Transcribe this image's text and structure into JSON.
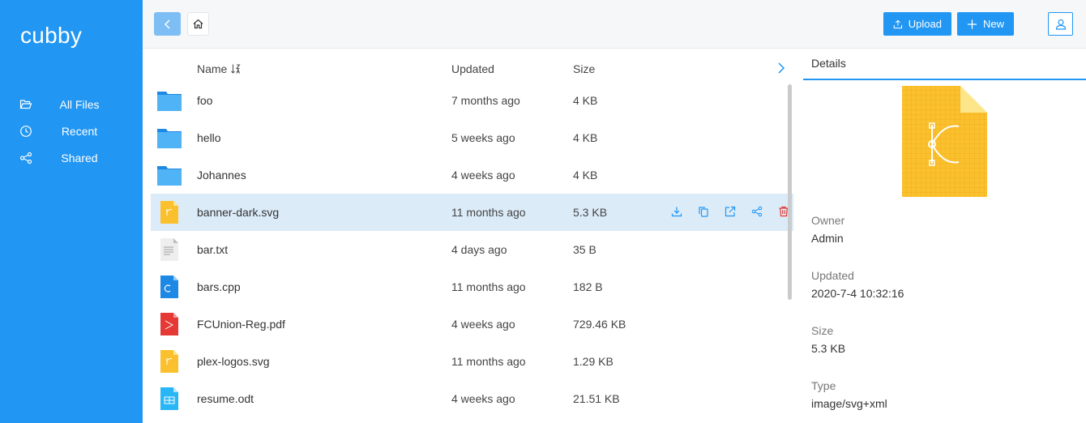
{
  "sidebar": {
    "brand": "cubby",
    "items": [
      {
        "label": "All Files",
        "icon": "folder-open-icon"
      },
      {
        "label": "Recent",
        "icon": "clock-icon"
      },
      {
        "label": "Shared",
        "icon": "share-icon"
      }
    ]
  },
  "toolbar": {
    "upload_label": "Upload",
    "new_label": "New"
  },
  "table": {
    "columns": {
      "name": "Name",
      "updated": "Updated",
      "size": "Size"
    },
    "rows": [
      {
        "name": "foo",
        "updated": "7 months ago",
        "size": "4 KB",
        "type": "folder"
      },
      {
        "name": "hello",
        "updated": "5 weeks ago",
        "size": "4 KB",
        "type": "folder"
      },
      {
        "name": "Johannes",
        "updated": "4 weeks ago",
        "size": "4 KB",
        "type": "folder"
      },
      {
        "name": "banner-dark.svg",
        "updated": "11 months ago",
        "size": "5.3 KB",
        "type": "svg",
        "selected": true
      },
      {
        "name": "bar.txt",
        "updated": "4 days ago",
        "size": "35 B",
        "type": "txt"
      },
      {
        "name": "bars.cpp",
        "updated": "11 months ago",
        "size": "182 B",
        "type": "cpp"
      },
      {
        "name": "FCUnion-Reg.pdf",
        "updated": "4 weeks ago",
        "size": "729.46 KB",
        "type": "pdf"
      },
      {
        "name": "plex-logos.svg",
        "updated": "11 months ago",
        "size": "1.29 KB",
        "type": "svg"
      },
      {
        "name": "resume.odt",
        "updated": "4 weeks ago",
        "size": "21.51 KB",
        "type": "odt"
      }
    ]
  },
  "details": {
    "tab": "Details",
    "owner_label": "Owner",
    "owner": "Admin",
    "updated_label": "Updated",
    "updated": "2020-7-4 10:32:16",
    "size_label": "Size",
    "size": "5.3 KB",
    "type_label": "Type",
    "type": "image/svg+xml"
  },
  "colors": {
    "primary": "#2196f3",
    "selected_row": "#dcebf8",
    "delete": "#e53935"
  }
}
